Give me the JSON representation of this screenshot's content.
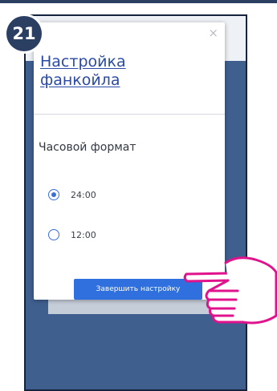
{
  "step": {
    "number": "21"
  },
  "dialog": {
    "close_label": "×",
    "title_line1": "Настройка",
    "title_line2": "фанкойла",
    "section_label": "Часовой формат",
    "options": [
      {
        "label": "24:00",
        "selected": true
      },
      {
        "label": "12:00",
        "selected": false
      }
    ],
    "finish_button": "Завершить настройку"
  },
  "background": {
    "card_text": "..."
  },
  "colors": {
    "accent": "#2f6fde",
    "title": "#2a4aa6",
    "phone_bg": "#3f5f8f",
    "badge": "#2b3f63",
    "hand_outline": "#e0138c"
  },
  "icons": {
    "hand": "pointing-hand-icon",
    "close": "close-icon"
  }
}
